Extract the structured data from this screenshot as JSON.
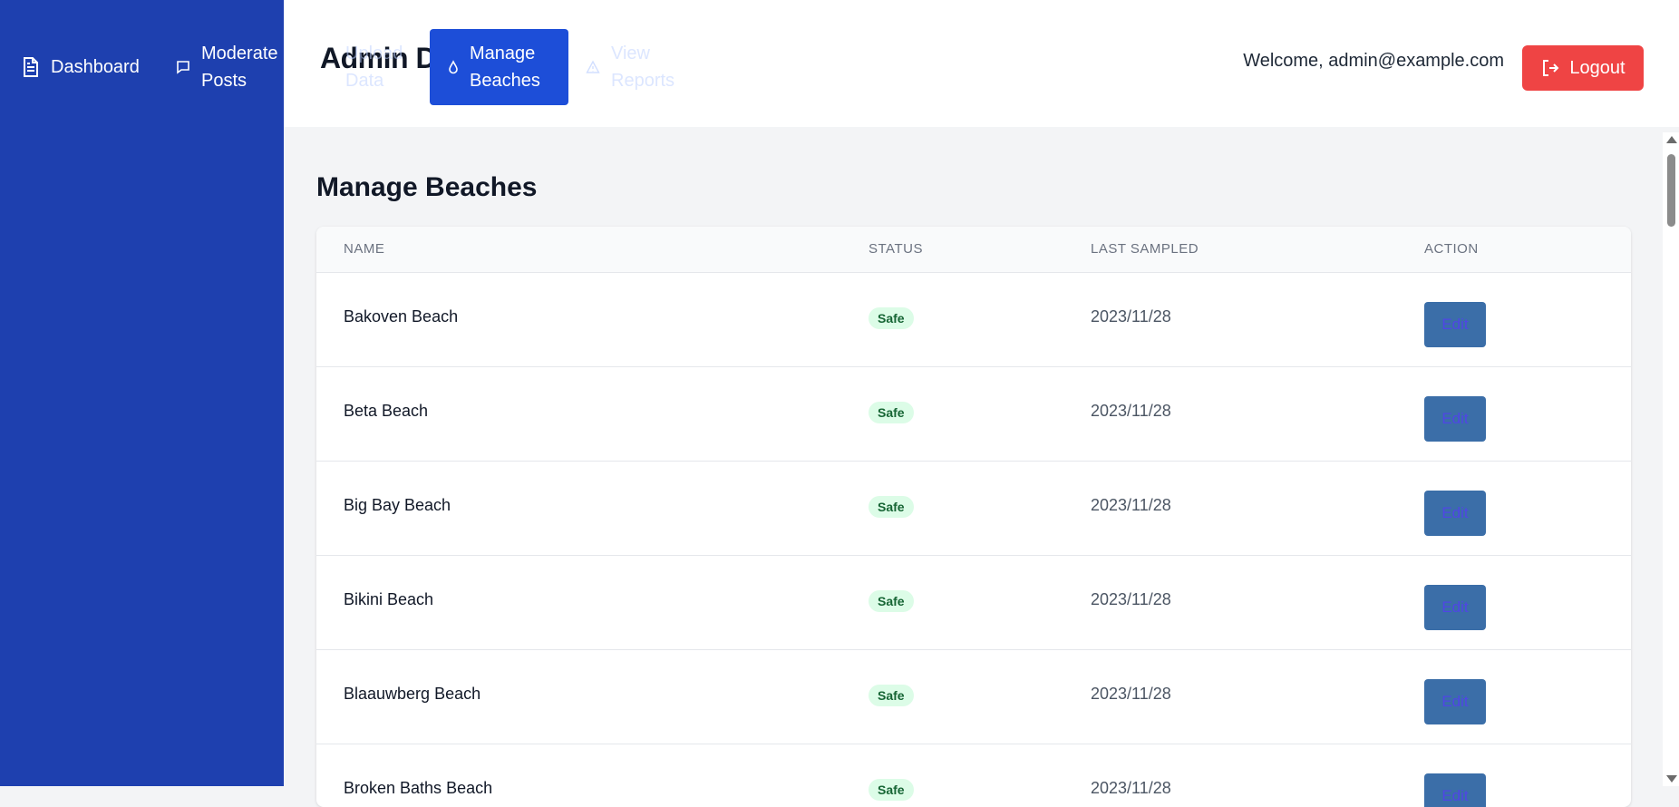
{
  "header": {
    "brand_title": "Admin Dashboard",
    "welcome": "Welcome, admin@example.com",
    "logout_label": "Logout"
  },
  "nav": {
    "dashboard": "Dashboard",
    "moderate_posts": "Moderate Posts",
    "upload_data": "Upload Data",
    "manage_beaches": "Manage Beaches",
    "view_reports": "View Reports"
  },
  "main": {
    "title": "Manage Beaches",
    "columns": [
      "Name",
      "Status",
      "Last Sampled",
      "Action"
    ],
    "rows": [
      {
        "name": "Bakoven Beach",
        "status": "Safe",
        "last_sampled": "2023/11/28",
        "action": "Edit"
      },
      {
        "name": "Beta Beach",
        "status": "Safe",
        "last_sampled": "2023/11/28",
        "action": "Edit"
      },
      {
        "name": "Big Bay Beach",
        "status": "Safe",
        "last_sampled": "2023/11/28",
        "action": "Edit"
      },
      {
        "name": "Bikini Beach",
        "status": "Safe",
        "last_sampled": "2023/11/28",
        "action": "Edit"
      },
      {
        "name": "Blaauwberg Beach",
        "status": "Safe",
        "last_sampled": "2023/11/28",
        "action": "Edit"
      },
      {
        "name": "Broken Baths Beach",
        "status": "Safe",
        "last_sampled": "2023/11/28",
        "action": "Edit"
      }
    ]
  },
  "colors": {
    "sidebar": "#1e40af",
    "active_nav": "#1d4ed8",
    "logout": "#ef4444",
    "safe_badge_bg": "#dcfce7",
    "safe_badge_text": "#166534",
    "edit_button": "#3b6ea8"
  },
  "icons": {
    "dashboard": "document-icon",
    "moderate_posts": "message-icon",
    "manage_beaches": "droplet-icon",
    "view_reports": "warning-icon",
    "logout": "logout-icon"
  }
}
